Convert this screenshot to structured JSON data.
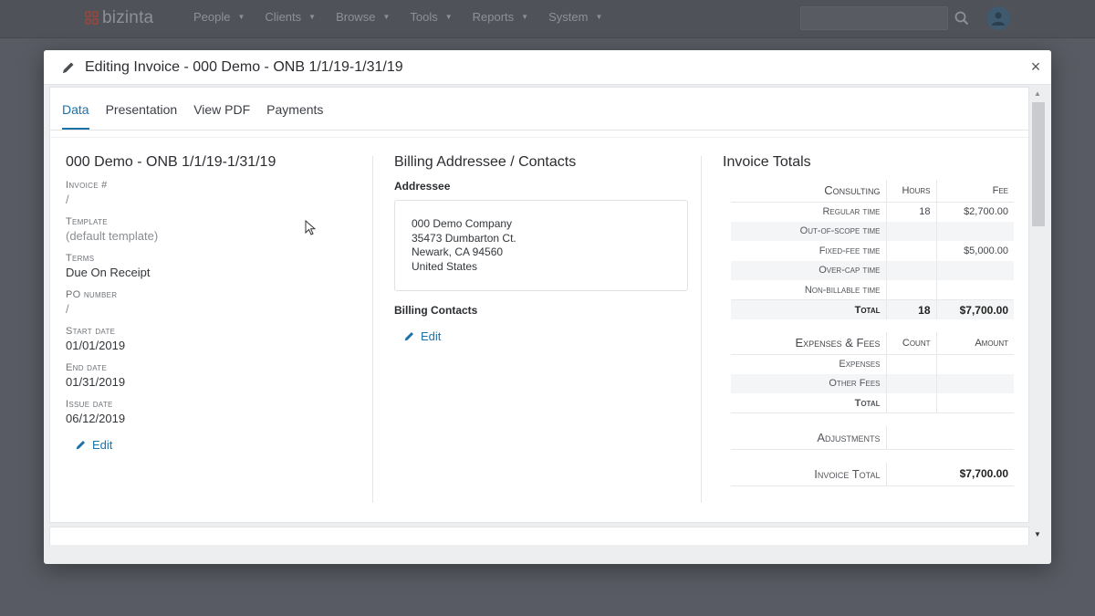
{
  "app": {
    "logo_text": "bizinta",
    "brand_color": "#8a4a42",
    "menu": [
      {
        "label": "People"
      },
      {
        "label": "Clients"
      },
      {
        "label": "Browse"
      },
      {
        "label": "Tools"
      },
      {
        "label": "Reports"
      },
      {
        "label": "System"
      }
    ]
  },
  "modal": {
    "title": "Editing Invoice - 000 Demo - ONB 1/1/19-1/31/19",
    "close_label": "×",
    "tabs": [
      {
        "label": "Data",
        "active": true
      },
      {
        "label": "Presentation",
        "active": false
      },
      {
        "label": "View PDF",
        "active": false
      },
      {
        "label": "Payments",
        "active": false
      }
    ]
  },
  "details": {
    "heading": "000 Demo - ONB 1/1/19-1/31/19",
    "fields": [
      {
        "label": "Invoice #",
        "value": "/"
      },
      {
        "label": "Template",
        "value": "(default template)"
      },
      {
        "label": "Terms",
        "value": "Due On Receipt"
      },
      {
        "label": "PO number",
        "value": "/"
      },
      {
        "label": "Start date",
        "value": "01/01/2019"
      },
      {
        "label": "End date",
        "value": "01/31/2019"
      },
      {
        "label": "Issue date",
        "value": "06/12/2019"
      }
    ],
    "edit_label": "Edit"
  },
  "billing": {
    "heading": "Billing Addressee / Contacts",
    "addressee_label": "Addressee",
    "address_lines": [
      "000 Demo Company",
      "35473 Dumbarton Ct.",
      "Newark, CA 94560",
      "United States"
    ],
    "contacts_label": "Billing Contacts",
    "edit_label": "Edit"
  },
  "totals": {
    "heading": "Invoice Totals",
    "consulting": {
      "label": "Consulting",
      "col_hours": "Hours",
      "col_fee": "Fee",
      "rows": [
        {
          "label": "Regular time",
          "hours": "18",
          "fee": "$2,700.00"
        },
        {
          "label": "Out-of-scope time",
          "hours": "",
          "fee": ""
        },
        {
          "label": "Fixed-fee time",
          "hours": "",
          "fee": "$5,000.00"
        },
        {
          "label": "Over-cap time",
          "hours": "",
          "fee": ""
        },
        {
          "label": "Non-billable time",
          "hours": "",
          "fee": ""
        }
      ],
      "total_label": "Total",
      "total_hours": "18",
      "total_fee": "$7,700.00"
    },
    "expenses": {
      "label": "Expenses & Fees",
      "col_count": "Count",
      "col_amount": "Amount",
      "rows": [
        {
          "label": "Expenses",
          "count": "",
          "amount": ""
        },
        {
          "label": "Other Fees",
          "count": "",
          "amount": ""
        }
      ],
      "total_label": "Total"
    },
    "adjustments_label": "Adjustments",
    "invoice_total_label": "Invoice Total",
    "invoice_total_value": "$7,700.00"
  },
  "colors": {
    "accent": "#1a72a8",
    "backdrop": "#585b63"
  }
}
